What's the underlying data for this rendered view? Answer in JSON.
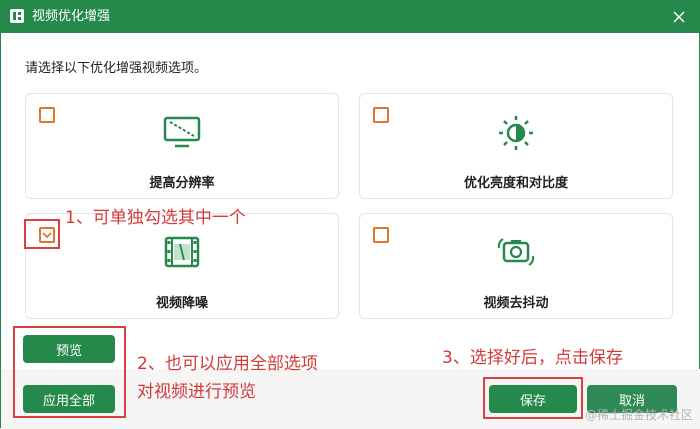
{
  "window": {
    "title": "视频优化增强",
    "close": "×"
  },
  "instruction": "请选择以下优化增强视频选项。",
  "options": [
    {
      "label": "提高分辨率",
      "checked": false,
      "icon": "monitor-icon"
    },
    {
      "label": "优化亮度和对比度",
      "checked": false,
      "icon": "brightness-icon"
    },
    {
      "label": "视频降噪",
      "checked": true,
      "icon": "film-icon"
    },
    {
      "label": "视频去抖动",
      "checked": false,
      "icon": "camera-stabilize-icon"
    }
  ],
  "buttons": {
    "preview": "预览",
    "apply_all": "应用全部",
    "save": "保存",
    "cancel": "取消"
  },
  "annotations": {
    "a1": "1、可单独勾选其中一个",
    "a2_line1": "2、也可以应用全部选项",
    "a2_line2": "对视频进行预览",
    "a3": "3、选择好后，点击保存"
  },
  "watermark": "@稀土掘金技术社区",
  "colors": {
    "primary": "#24894b",
    "checkbox": "#e0762c",
    "annotation": "#d33a3a"
  }
}
